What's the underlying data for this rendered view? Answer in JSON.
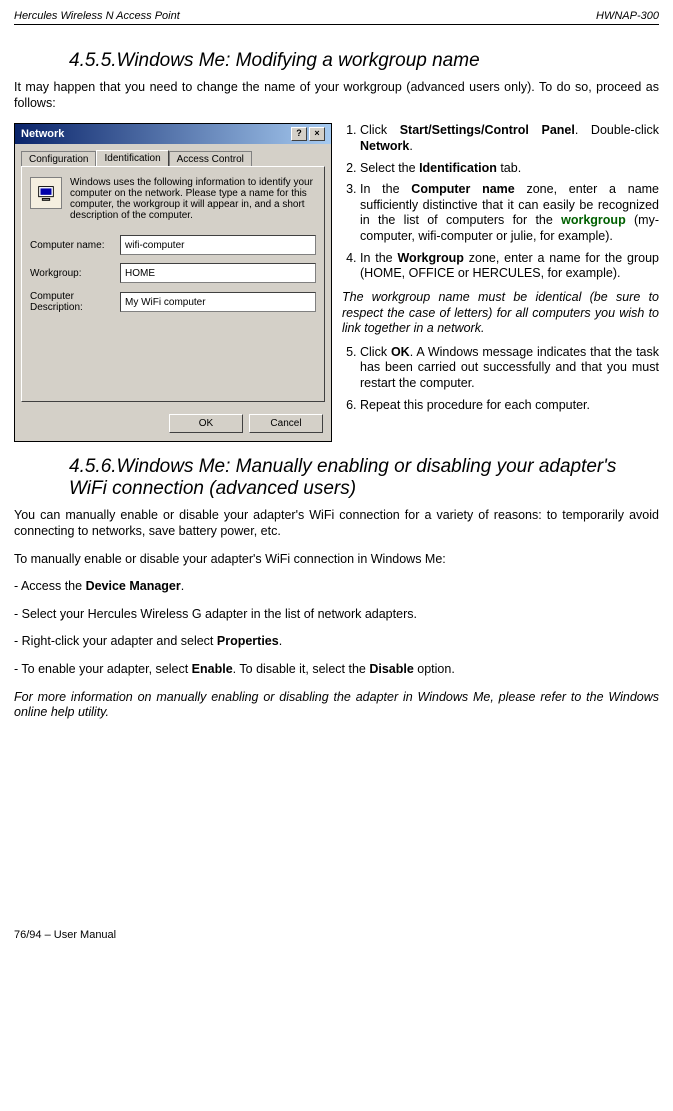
{
  "header": {
    "left": "Hercules Wireless N Access Point",
    "right": "HWNAP-300"
  },
  "section1": {
    "number": "4.5.5.",
    "title": "Windows Me: Modifying a workgroup name",
    "intro": "It may happen that you need to change the name of your workgroup (advanced users only).  To do so, proceed as follows:",
    "screenshot": {
      "title": "Network",
      "tabs": [
        "Configuration",
        "Identification",
        "Access Control"
      ],
      "activeTab": 1,
      "infoText": "Windows uses the following information to identify your computer on the network.  Please type a name for this computer, the workgroup it will appear in, and a short description of the computer.",
      "fields": {
        "computerNameLabel": "Computer name:",
        "computerNameValue": "wifi-computer",
        "workgroupLabel": "Workgroup:",
        "workgroupValue": "HOME",
        "descriptionLabel": "Computer Description:",
        "descriptionValue": "My WiFi computer"
      },
      "okLabel": "OK",
      "cancelLabel": "Cancel"
    },
    "steps": {
      "s1a": "Click ",
      "s1b": "Start/Settings/Control Panel",
      "s1c": ".  Double-click ",
      "s1d": "Network",
      "s1e": ".",
      "s2a": "Select the ",
      "s2b": "Identification",
      "s2c": " tab.",
      "s3a": "In the ",
      "s3b": "Computer name",
      "s3c": " zone, enter a name sufficiently distinctive that it can easily be recognized in the list of computers for the ",
      "s3d": "workgroup",
      "s3e": " (my-computer, wifi-computer or julie, for example).",
      "s4a": "In the ",
      "s4b": "Workgroup",
      "s4c": " zone, enter a name for the group (HOME, OFFICE or HERCULES, for example).",
      "note": "The workgroup name must be identical (be sure to respect the case of letters) for all computers you wish to link together in a network.",
      "s5a": "Click ",
      "s5b": "OK",
      "s5c": ".  A Windows message indicates that the task has been carried out successfully and that you must restart the computer.",
      "s6": "Repeat this procedure for each computer."
    }
  },
  "section2": {
    "number": "4.5.6.",
    "title": "Windows Me:  Manually enabling or disabling your adapter's WiFi connection (advanced users)",
    "p1": "You can manually enable or disable your adapter's WiFi connection for a variety of reasons: to temporarily avoid connecting to networks, save battery power, etc.",
    "p2": "To manually enable or disable your adapter's WiFi connection in Windows Me:",
    "b1a": "- Access the ",
    "b1b": "Device Manager",
    "b1c": ".",
    "b2": "- Select your Hercules Wireless G adapter in the list of network adapters.",
    "b3a": "- Right-click your adapter and select ",
    "b3b": "Properties",
    "b3c": ".",
    "b4a": "- To enable your adapter, select ",
    "b4b": "Enable",
    "b4c": ".  To disable it, select the ",
    "b4d": "Disable",
    "b4e": " option.",
    "note": "For more information on manually enabling or disabling the adapter in Windows Me, please refer to the Windows online help utility."
  },
  "footer": "76/94 – User Manual"
}
